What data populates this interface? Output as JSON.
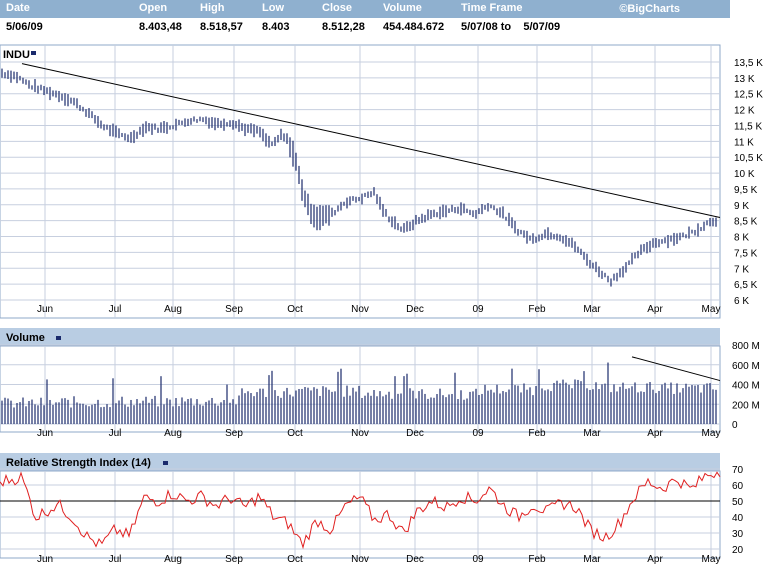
{
  "header": {
    "brand": "©BigCharts",
    "columns": [
      {
        "label": "Date",
        "value": "5/06/09"
      },
      {
        "label": "Open",
        "value": "8.403,48"
      },
      {
        "label": "High",
        "value": "8.518,57"
      },
      {
        "label": "Low",
        "value": "8.403"
      },
      {
        "label": "Close",
        "value": "8.512,28"
      },
      {
        "label": "Volume",
        "value": "454.484.672"
      },
      {
        "label": "Time Frame",
        "value": "5/07/08 to    5/07/09"
      }
    ]
  },
  "chart_data": [
    {
      "type": "ohlc",
      "title": "INDU",
      "x_labels": [
        "Jun",
        "Jul",
        "Aug",
        "Sep",
        "Oct",
        "Nov",
        "Dec",
        "09",
        "Feb",
        "Mar",
        "Apr",
        "May"
      ],
      "y_ticks": [
        "6 K",
        "6,5 K",
        "7 K",
        "7,5 K",
        "8 K",
        "8,5 K",
        "9 K",
        "9,5 K",
        "10 K",
        "10,5 K",
        "11 K",
        "11,5 K",
        "12 K",
        "12,5 K",
        "13 K",
        "13,5 K"
      ],
      "ylim": [
        6000,
        13500
      ],
      "series_approx": [
        [
          0,
          13150
        ],
        [
          0.02,
          13050
        ],
        [
          0.04,
          12750
        ],
        [
          0.06,
          12600
        ],
        [
          0.08,
          12450
        ],
        [
          0.1,
          12250
        ],
        [
          0.12,
          11900
        ],
        [
          0.14,
          11500
        ],
        [
          0.16,
          11250
        ],
        [
          0.18,
          11100
        ],
        [
          0.2,
          11450
        ],
        [
          0.22,
          11400
        ],
        [
          0.24,
          11500
        ],
        [
          0.26,
          11650
        ],
        [
          0.28,
          11700
        ],
        [
          0.3,
          11550
        ],
        [
          0.32,
          11600
        ],
        [
          0.34,
          11400
        ],
        [
          0.36,
          11300
        ],
        [
          0.37,
          11000
        ],
        [
          0.38,
          10900
        ],
        [
          0.39,
          11200
        ],
        [
          0.4,
          11000
        ],
        [
          0.41,
          10400
        ],
        [
          0.42,
          9400
        ],
        [
          0.43,
          8800
        ],
        [
          0.44,
          8600
        ],
        [
          0.46,
          8700
        ],
        [
          0.48,
          9100
        ],
        [
          0.5,
          9200
        ],
        [
          0.52,
          9400
        ],
        [
          0.53,
          8900
        ],
        [
          0.54,
          8600
        ],
        [
          0.56,
          8200
        ],
        [
          0.58,
          8500
        ],
        [
          0.6,
          8700
        ],
        [
          0.62,
          8800
        ],
        [
          0.64,
          8900
        ],
        [
          0.66,
          8700
        ],
        [
          0.68,
          9000
        ],
        [
          0.7,
          8700
        ],
        [
          0.72,
          8200
        ],
        [
          0.74,
          7900
        ],
        [
          0.76,
          8100
        ],
        [
          0.78,
          8000
        ],
        [
          0.8,
          7700
        ],
        [
          0.82,
          7200
        ],
        [
          0.84,
          6800
        ],
        [
          0.85,
          6600
        ],
        [
          0.87,
          7000
        ],
        [
          0.89,
          7500
        ],
        [
          0.91,
          7800
        ],
        [
          0.93,
          7900
        ],
        [
          0.95,
          8000
        ],
        [
          0.97,
          8200
        ],
        [
          0.99,
          8500
        ],
        [
          1.0,
          8512
        ]
      ],
      "trendline": [
        [
          13450
        ],
        [
          8600
        ]
      ]
    },
    {
      "type": "bar",
      "title": "Volume",
      "y_ticks": [
        "0",
        "200 M",
        "400 M",
        "600 M",
        "800 M"
      ],
      "ylim": [
        0,
        800
      ],
      "series_approx_by_month": [
        200,
        210,
        215,
        220,
        310,
        320,
        300,
        290,
        340,
        380,
        360,
        350
      ],
      "trendline": [
        [
          680
        ],
        [
          440
        ]
      ]
    },
    {
      "type": "line",
      "title": "Relative Strength Index (14)",
      "y_ticks": [
        "20",
        "30",
        "40",
        "50",
        "60",
        "70"
      ],
      "ylim": [
        20,
        70
      ],
      "reference_line": 50,
      "series_approx": [
        [
          0,
          62
        ],
        [
          0.03,
          65
        ],
        [
          0.05,
          40
        ],
        [
          0.08,
          48
        ],
        [
          0.1,
          40
        ],
        [
          0.12,
          28
        ],
        [
          0.14,
          22
        ],
        [
          0.16,
          32
        ],
        [
          0.18,
          28
        ],
        [
          0.2,
          52
        ],
        [
          0.22,
          50
        ],
        [
          0.24,
          55
        ],
        [
          0.26,
          50
        ],
        [
          0.28,
          53
        ],
        [
          0.3,
          47
        ],
        [
          0.32,
          52
        ],
        [
          0.34,
          46
        ],
        [
          0.36,
          53
        ],
        [
          0.38,
          40
        ],
        [
          0.4,
          36
        ],
        [
          0.42,
          23
        ],
        [
          0.44,
          38
        ],
        [
          0.46,
          32
        ],
        [
          0.48,
          47
        ],
        [
          0.5,
          52
        ],
        [
          0.52,
          38
        ],
        [
          0.54,
          42
        ],
        [
          0.56,
          30
        ],
        [
          0.58,
          44
        ],
        [
          0.6,
          50
        ],
        [
          0.62,
          46
        ],
        [
          0.64,
          53
        ],
        [
          0.66,
          50
        ],
        [
          0.68,
          58
        ],
        [
          0.7,
          47
        ],
        [
          0.72,
          40
        ],
        [
          0.74,
          48
        ],
        [
          0.76,
          43
        ],
        [
          0.78,
          49
        ],
        [
          0.8,
          46
        ],
        [
          0.82,
          32
        ],
        [
          0.84,
          27
        ],
        [
          0.86,
          36
        ],
        [
          0.88,
          52
        ],
        [
          0.9,
          62
        ],
        [
          0.92,
          58
        ],
        [
          0.94,
          64
        ],
        [
          0.96,
          57
        ],
        [
          0.98,
          66
        ],
        [
          1.0,
          69
        ]
      ]
    }
  ]
}
